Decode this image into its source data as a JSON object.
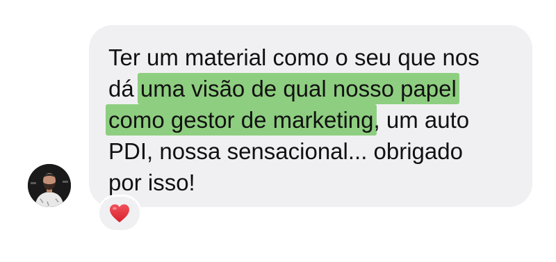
{
  "message": {
    "lines": [
      "Ter um material como o seu que nos",
      "dá ",
      "uma visão de qual nosso papel",
      "como gestor de marketing",
      ", um auto",
      "PDI, nossa sensacional... obrigado",
      "por isso!"
    ],
    "highlight_color": "#7cc86c",
    "bubble_color": "#f0f0f2"
  },
  "reaction": {
    "emoji": "heart-icon",
    "color": "#e8333c"
  },
  "avatar": {
    "icon": "profile-photo"
  }
}
